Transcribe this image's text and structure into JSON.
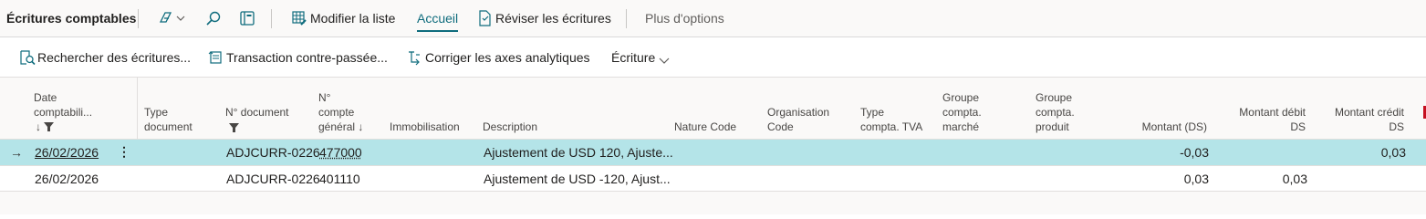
{
  "page_title": "Écritures comptables",
  "toolbar": {
    "modify_list": "Modifier la liste",
    "home_tab": "Accueil",
    "review_entries": "Réviser les écritures",
    "more_options": "Plus d'options"
  },
  "actions": {
    "search_entries": "Rechercher des écritures...",
    "reverse_transaction": "Transaction contre-passée...",
    "correct_dimensions": "Corriger les axes analytiques",
    "entry_menu": "Écriture"
  },
  "columns": {
    "posting_date": [
      "Date",
      "comptabili..."
    ],
    "doc_type": [
      "Type",
      "document"
    ],
    "doc_no": "N° document",
    "gl_account": [
      "N°",
      "compte",
      "général ↓"
    ],
    "fixed_asset": "Immobilisation",
    "description": "Description",
    "nature_code": "Nature Code",
    "org_code": [
      "Organisation",
      "Code"
    ],
    "vat_type": [
      "Type",
      "compta. TVA"
    ],
    "gen_bus_group": [
      "Groupe",
      "compta.",
      "marché"
    ],
    "gen_prod_group": [
      "Groupe",
      "compta.",
      "produit"
    ],
    "amount": "Montant (DS)",
    "debit": [
      "Montant débit",
      "DS"
    ],
    "credit": [
      "Montant crédit",
      "DS"
    ]
  },
  "rows": [
    {
      "date": "26/02/2026",
      "doc_no": "ADJCURR-0226",
      "account": "477000",
      "description": "Ajustement de USD 120, Ajuste...",
      "amount": "-0,03",
      "debit": "",
      "credit": "0,03"
    },
    {
      "date": "26/02/2026",
      "doc_no": "ADJCURR-0226",
      "account": "401110",
      "description": "Ajustement de USD -120, Ajust...",
      "amount": "0,03",
      "debit": "0,03",
      "credit": ""
    }
  ],
  "colors": {
    "accent": "#0f6c7d",
    "selected_row": "#b4e4e8"
  }
}
